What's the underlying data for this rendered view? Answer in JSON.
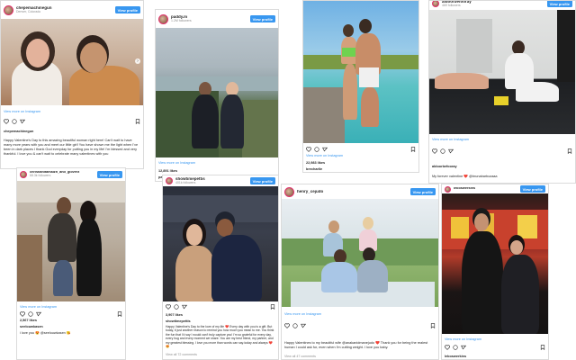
{
  "common": {
    "view_profile": "View profile",
    "view_more": "View more on Instagram"
  },
  "post1": {
    "username": "chepemachinegun",
    "location": "Denver, Colorado",
    "bottom_username": "chepemachinegun",
    "caption": "Happy Valentine's Day to this amazing beautiful woman right here! Can't wait to have many more years with you and meet our little girl! You have shown me the light when I've been in dark places I thank God everyday for putting you in my life! I'm blessed and very thankful. I love you & can't wait to celebrate many valentines with you"
  },
  "post2": {
    "username": "paddy.m",
    "followers": "1.2M followers",
    "likes": "12,891 likes",
    "bottom_username": "paddythebaddy"
  },
  "post3": {
    "username": "brecharlie",
    "followers": "",
    "likes": "22,983 likes",
    "bottom_username": "brecharlie",
    "view_all": "View all comments"
  },
  "post4": {
    "username": "aldoorbefooray",
    "followers": "469 followers",
    "bottom_username": "aldoorbefooray",
    "caption": "My forever valentine ❤️ @brunabarbozaaa"
  },
  "post5": {
    "username": "christianitamaizh_and_gloverz",
    "followers": "68.3k followers",
    "likes": "2,567 likes",
    "bottom_username": "seelouwkasen",
    "caption": "i love you 😍 @seelouwkasen 😘"
  },
  "post6": {
    "username": "showtimepettis",
    "followers": "401k followers",
    "likes": "3,907 likes",
    "bottom_username": "showtimepettis",
    "caption": "Happy Valentine's Day to the love of my life ❤️ Every day with you is a gift. But today, it just another reason to remind you how much you mean to me. You think the fun that I'd say I would can't truly capture you! I'm so grateful for every day, every hug and every moment we share. You are my best friend, my partner, and my greatest blessing. I love you more than words can say-today and always ❤️ 😍",
    "view_all": "View all 72 comments"
  },
  "post7": {
    "username": "henry_cejudo",
    "followers": "",
    "likes": "",
    "bottom_username": "henry_cejudo",
    "caption": "Happy Valentines to my beautiful wife @anakanidmanejudo ❤️ Thank you for being the realest human I could ask for, even when I'm cutting weight. I love you baby.",
    "view_all": "View all 47 comments"
  },
  "post8": {
    "username": "leboswerkins",
    "followers": "",
    "likes": "",
    "bottom_username": "leboswerkins"
  }
}
